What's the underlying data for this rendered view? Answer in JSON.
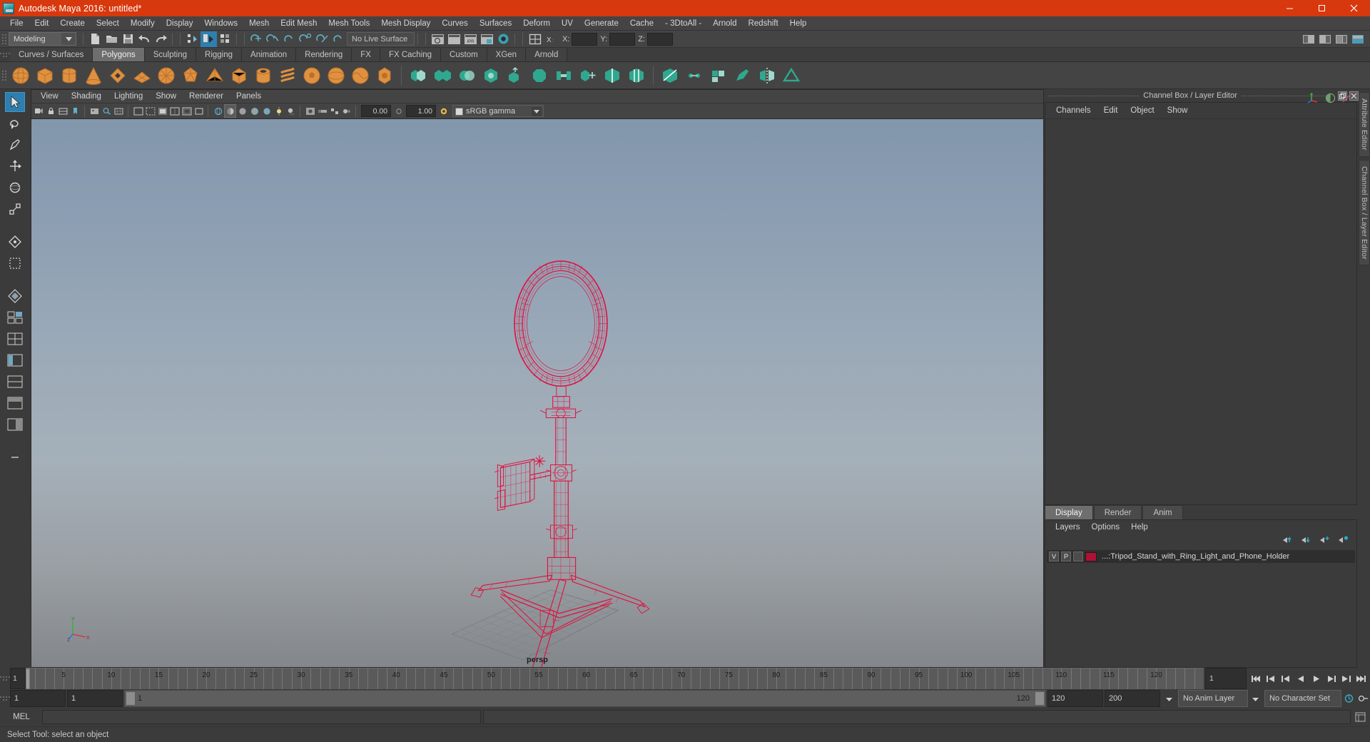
{
  "window": {
    "title": "Autodesk Maya 2016: untitled*",
    "logo_icon": "maya-logo-icon",
    "minimize_icon": "minimize-icon",
    "maximize_icon": "maximize-icon",
    "close_icon": "close-icon",
    "titlebar_color": "#d8380d"
  },
  "menubar": {
    "items": [
      "File",
      "Edit",
      "Create",
      "Select",
      "Modify",
      "Display",
      "Windows",
      "Mesh",
      "Edit Mesh",
      "Mesh Tools",
      "Mesh Display",
      "Curves",
      "Surfaces",
      "Deform",
      "UV",
      "Generate",
      "Cache",
      "- 3DtoAll -",
      "Arnold",
      "Redshift",
      "Help"
    ]
  },
  "statusbar": {
    "menu_set": "Modeling",
    "live_surface": "No Live Surface",
    "coord_labels": [
      "X:",
      "Y:",
      "Z:"
    ],
    "coord_values": [
      "",
      "",
      ""
    ],
    "file_icons": [
      "new-scene-icon",
      "open-scene-icon",
      "save-scene-icon",
      "undo-icon",
      "redo-icon"
    ],
    "select_mode_icons": [
      "select-by-hierarchy-icon",
      "select-by-object-type-icon",
      "select-by-component-type-icon"
    ],
    "snap_icons": [
      "snap-to-grids-icon",
      "snap-to-curves-icon",
      "snap-to-points-icon",
      "snap-to-projected-center-icon",
      "snap-to-view-planes-icon",
      "make-live-icon"
    ],
    "render_icons": [
      "render-current-frame-icon",
      "ipr-render-icon",
      "render-settings-icon",
      "hypershade-icon",
      "render-view-icon"
    ],
    "editor_icons": [
      "open-outliner-icon",
      "open-attribute-editor-icon",
      "open-tool-settings-icon",
      "open-channel-box-icon"
    ]
  },
  "shelf": {
    "tabs": [
      "Curves / Surfaces",
      "Polygons",
      "Sculpting",
      "Rigging",
      "Animation",
      "Rendering",
      "FX",
      "FX Caching",
      "Custom",
      "XGen",
      "Arnold"
    ],
    "active_tab": "Polygons",
    "icons": [
      "poly-sphere-icon",
      "poly-cube-icon",
      "poly-cylinder-icon",
      "poly-cone-icon",
      "poly-torus-icon",
      "poly-plane-icon",
      "poly-disc-icon",
      "poly-platonic-icon",
      "poly-pyramid-icon",
      "poly-prism-icon",
      "poly-pipe-icon",
      "poly-helix-icon",
      "poly-soccer-ball-icon",
      "poly-super-ellipse-icon",
      "poly-spherical-harmonics-icon",
      "poly-ultra-shape-icon",
      "combine-icon",
      "separate-icon",
      "booleans-icon",
      "smooth-icon",
      "extrude-icon",
      "bevel-icon",
      "bridge-icon",
      "append-polygon-icon",
      "insert-edge-loop-icon",
      "offset-edge-loop-icon",
      "multi-cut-icon",
      "target-weld-icon",
      "quad-draw-icon",
      "sculpt-icon",
      "mirror-icon",
      "crease-icon"
    ]
  },
  "toolbox": {
    "items": [
      "select-tool-icon",
      "lasso-select-tool-icon",
      "paint-select-tool-icon",
      "move-tool-icon",
      "rotate-tool-icon",
      "scale-tool-icon",
      "universal-manipulator-icon",
      "soft-modification-tool-icon",
      "last-tool-used-icon",
      "single-perspective-view-icon",
      "four-view-layout-icon",
      "persp-outliner-layout-icon",
      "persp-graph-layout-icon",
      "hypershade-persp-layout-icon",
      "persp-render-layout-icon",
      "quick-layout-more-icon"
    ],
    "selected": "select-tool-icon"
  },
  "viewport": {
    "menus": [
      "View",
      "Shading",
      "Lighting",
      "Show",
      "Renderer",
      "Panels"
    ],
    "toolbar_icons": [
      "select-camera-icon",
      "lock-camera-icon",
      "camera-attributes-icon",
      "bookmark-icon",
      "image-plane-icon",
      "two-d-pan-zoom-icon",
      "grid-toggle-icon",
      "film-gate-icon",
      "resolution-gate-icon",
      "gate-mask-icon",
      "field-chart-icon",
      "safe-action-icon",
      "safe-title-icon",
      "wireframe-icon",
      "smooth-shade-all-icon",
      "shade-options-icon",
      "wireframe-on-shaded-icon",
      "texture-icon",
      "use-all-lights-icon",
      "shadows-icon",
      "screen-space-ao-icon",
      "motion-blur-icon",
      "multisample-icon",
      "depth-of-field-icon",
      "isolate-select-icon",
      "xray-icon",
      "xray-joints-icon"
    ],
    "exposure_value": "0.00",
    "gamma_value": "1.00",
    "color_space": "sRGB gamma",
    "camera_label": "persp",
    "axis_labels": [
      "Y",
      "X",
      "Z"
    ]
  },
  "model": {
    "name": "Tripod_Stand_with_Ring_Light_and_Phone_Holder",
    "wireframe_color": "#e0113f"
  },
  "channel_box": {
    "panel_title": "Channel Box / Layer Editor",
    "menus": [
      "Channels",
      "Edit",
      "Object",
      "Show"
    ],
    "header_icons": [
      "show-manipulators-icon",
      "show-channel-box-icon",
      "show-attribute-editor-icon"
    ],
    "float_icon": "undock-icon",
    "close_icon": "close-panel-icon"
  },
  "layer_editor": {
    "tabs": [
      "Display",
      "Render",
      "Anim"
    ],
    "active_tab": "Display",
    "menus": [
      "Layers",
      "Options",
      "Help"
    ],
    "button_icons": [
      "move-layer-up-icon",
      "move-layer-down-icon",
      "new-layer-icon",
      "new-layer-from-selected-icon"
    ],
    "layers": [
      {
        "visibility": "V",
        "playback": "P",
        "shading": "",
        "color": "#b01035",
        "name": "...:Tripod_Stand_with_Ring_Light_and_Phone_Holder"
      }
    ]
  },
  "side_tabs": [
    "Attribute Editor",
    "Channel Box / Layer Editor"
  ],
  "time_slider": {
    "current_frame": "1",
    "start_field": "1",
    "end_field": "120",
    "range_start": "1",
    "range_end": "120",
    "anim_start": "120",
    "anim_end": "200",
    "tick_labels": [
      "5",
      "10",
      "15",
      "20",
      "25",
      "30",
      "35",
      "40",
      "45",
      "50",
      "55",
      "60",
      "65",
      "70",
      "75",
      "80",
      "85",
      "90",
      "95",
      "100",
      "105",
      "110",
      "115",
      "120"
    ],
    "anim_layer": "No Anim Layer",
    "character_set": "No Character Set",
    "playback_icons": [
      "go-to-start-icon",
      "step-back-frame-icon",
      "step-back-key-icon",
      "play-backwards-icon",
      "play-forwards-icon",
      "step-forward-key-icon",
      "step-forward-frame-icon",
      "go-to-end-icon"
    ],
    "pref_icons": [
      "animation-preferences-icon",
      "auto-keyframe-icon"
    ]
  },
  "command_line": {
    "language_label": "MEL",
    "input_value": "",
    "output_value": ""
  },
  "status_line": {
    "help_text": "Select Tool: select an object"
  }
}
